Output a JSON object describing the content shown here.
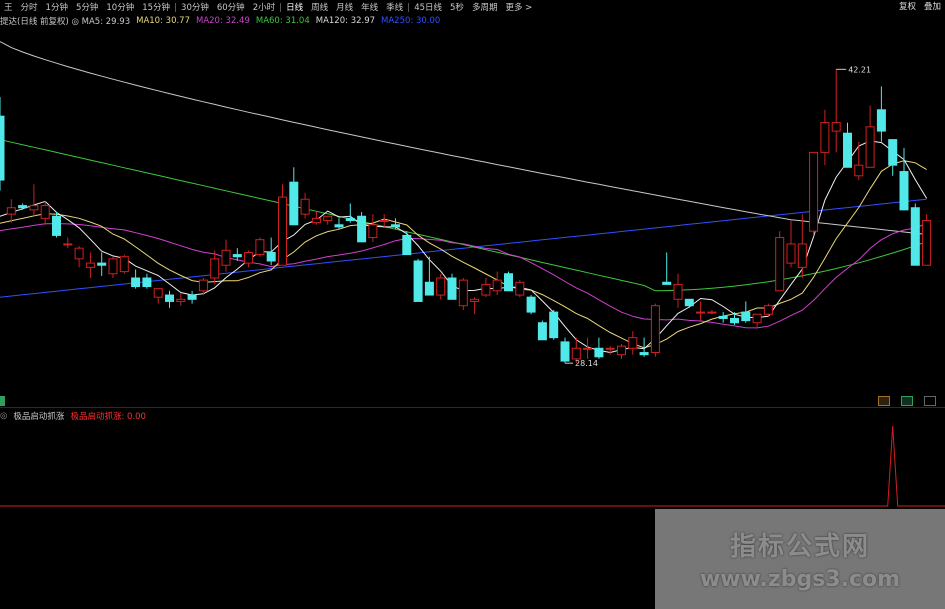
{
  "period_tabs": [
    "王",
    "分时",
    "1分钟",
    "5分钟",
    "10分钟",
    "15分钟",
    "30分钟",
    "60分钟",
    "2小时",
    "日线",
    "周线",
    "月线",
    "年线",
    "季线",
    "45日线",
    "5秒",
    "多周期",
    "更多 >"
  ],
  "active_tab": "日线",
  "right_tabs": [
    "复权",
    "叠加"
  ],
  "ma_legend": {
    "title": "提达(日线 前复权) ◎ MA5: 29.93",
    "items": [
      {
        "label": "MA10: 30.77",
        "color": "#e8d87a"
      },
      {
        "label": "MA20: 32.49",
        "color": "#d040d0"
      },
      {
        "label": "MA60: 31.04",
        "color": "#3cc83c"
      },
      {
        "label": "MA120: 32.97",
        "color": "#d8d8d8"
      },
      {
        "label": "MA250: 30.00",
        "color": "#3050ff"
      }
    ]
  },
  "indicator_legend": {
    "title": "极品启动抓涨",
    "value_label": "极品启动抓涨: 0.00"
  },
  "colors": {
    "up": "#d02020",
    "down": "#50e8e8",
    "ma5": "#f0f0f0",
    "ma10": "#e8d87a",
    "ma20": "#d040d0",
    "ma60": "#3cc83c",
    "ma120": "#c8c8c8",
    "ma250": "#3050ff",
    "signal": "#d02020"
  },
  "chart_data": {
    "type": "candlestick",
    "annotations": {
      "high_label": "42.21",
      "low_label": "28.14"
    },
    "ylim": [
      27,
      44
    ],
    "candles": [
      [
        40,
        40.9,
        36.5,
        37
      ],
      [
        35.4,
        36.1,
        35,
        35.7
      ],
      [
        35.8,
        35.9,
        35.6,
        35.7
      ],
      [
        35.6,
        36.8,
        35.3,
        35.8
      ],
      [
        35.2,
        36,
        34.9,
        35.8
      ],
      [
        35.3,
        35.5,
        34.3,
        34.4
      ],
      [
        34,
        34.3,
        33.8,
        34
      ],
      [
        33.3,
        33.9,
        32.9,
        33.8
      ],
      [
        32.9,
        33.6,
        32.4,
        33.1
      ],
      [
        33.1,
        33.6,
        32.5,
        33
      ],
      [
        32.6,
        33.4,
        32.4,
        33.3
      ],
      [
        32.7,
        33.5,
        32.6,
        33.4
      ],
      [
        32.4,
        32.8,
        31.9,
        32
      ],
      [
        32.4,
        32.6,
        31.9,
        32
      ],
      [
        31.5,
        31.9,
        31.2,
        31.9
      ],
      [
        31.6,
        31.8,
        31,
        31.3
      ],
      [
        31.3,
        31.7,
        31.1,
        31.4
      ],
      [
        31.6,
        31.8,
        31.2,
        31.4
      ],
      [
        31.8,
        32.4,
        31.6,
        32.3
      ],
      [
        32.4,
        33.7,
        32.1,
        33.3
      ],
      [
        33,
        34.2,
        32.7,
        33.7
      ],
      [
        33.5,
        33.8,
        33.2,
        33.4
      ],
      [
        33.1,
        33.7,
        32.9,
        33.6
      ],
      [
        33.5,
        34.3,
        33.4,
        34.2
      ],
      [
        33.6,
        34.3,
        33,
        33.2
      ],
      [
        33,
        36.8,
        33,
        36.2
      ],
      [
        36.9,
        37.6,
        34.9,
        34.9
      ],
      [
        35.4,
        36.4,
        35.2,
        36.1
      ],
      [
        35,
        35.5,
        34.9,
        35.2
      ],
      [
        35.1,
        35.3,
        34.9,
        35.3
      ],
      [
        34.9,
        35.2,
        34.7,
        34.8
      ],
      [
        35.2,
        35.9,
        35,
        35.1
      ],
      [
        35.3,
        35.5,
        34.1,
        34.1
      ],
      [
        34.3,
        35.4,
        34.1,
        34.9
      ],
      [
        35.1,
        35.4,
        34.8,
        35.1
      ],
      [
        34.9,
        35.2,
        34.7,
        34.8
      ],
      [
        34.4,
        34.6,
        33.5,
        33.5
      ],
      [
        33.2,
        33.3,
        31.3,
        31.3
      ],
      [
        32.2,
        33.4,
        31.6,
        31.6
      ],
      [
        31.6,
        32.6,
        31.4,
        32.4
      ],
      [
        32.4,
        32.6,
        31.4,
        31.4
      ],
      [
        31.1,
        32.4,
        30.9,
        32.3
      ],
      [
        31.3,
        31.5,
        30.7,
        31.4
      ],
      [
        31.6,
        32.4,
        31.5,
        32.1
      ],
      [
        31.8,
        32.7,
        31.6,
        32.3
      ],
      [
        32.6,
        32.7,
        31.8,
        31.8
      ],
      [
        31.6,
        32.3,
        31.5,
        32.2
      ],
      [
        31.5,
        31.6,
        30.7,
        30.8
      ],
      [
        30.3,
        30.4,
        29.5,
        29.5
      ],
      [
        30.8,
        30.9,
        29.5,
        29.6
      ],
      [
        29.4,
        29.6,
        28.4,
        28.5
      ],
      [
        28.6,
        29.6,
        28.4,
        29.1
      ],
      [
        29.1,
        29.6,
        28.6,
        29.1
      ],
      [
        29.1,
        29.6,
        28.6,
        28.7
      ],
      [
        29.1,
        29.2,
        28.8,
        29.1
      ],
      [
        28.8,
        29.3,
        28.6,
        29.2
      ],
      [
        29.1,
        29.9,
        28.8,
        29.6
      ],
      [
        28.9,
        29.6,
        28.7,
        28.8
      ],
      [
        28.9,
        31.2,
        28.7,
        31.1
      ],
      [
        32.2,
        33.6,
        32.1,
        32.1
      ],
      [
        31.4,
        32.6,
        31,
        32.1
      ],
      [
        31.4,
        31.4,
        31,
        31.1
      ],
      [
        30.8,
        31.3,
        30.4,
        30.8
      ],
      [
        30.8,
        30.9,
        30.7,
        30.8
      ],
      [
        30.6,
        30.8,
        30.3,
        30.5
      ],
      [
        30.5,
        30.8,
        30.2,
        30.3
      ],
      [
        30.8,
        31.3,
        30.3,
        30.4
      ],
      [
        30.3,
        30.7,
        30.1,
        30.7
      ],
      [
        30.7,
        31.2,
        30.6,
        31.1
      ],
      [
        31.8,
        34.6,
        31.8,
        34.3
      ],
      [
        33.1,
        35.1,
        32.9,
        34
      ],
      [
        32.9,
        35.4,
        32.4,
        34
      ],
      [
        34.6,
        38.3,
        34.4,
        38.3
      ],
      [
        38.3,
        40.3,
        37.7,
        39.7
      ],
      [
        39.3,
        42.2,
        38.3,
        39.7
      ],
      [
        39.2,
        39.7,
        37.6,
        37.6
      ],
      [
        37.2,
        38.8,
        37,
        37.7
      ],
      [
        37.6,
        40.5,
        37.6,
        39.5
      ],
      [
        40.3,
        41.4,
        38.8,
        39.3
      ],
      [
        38.9,
        38.9,
        37.2,
        37.7
      ],
      [
        37.4,
        38.5,
        35.6,
        35.6
      ],
      [
        35.7,
        35.9,
        33,
        33
      ],
      [
        33,
        35.4,
        33,
        35.1
      ]
    ],
    "signal_index": 79,
    "signal_value": 1.0
  }
}
